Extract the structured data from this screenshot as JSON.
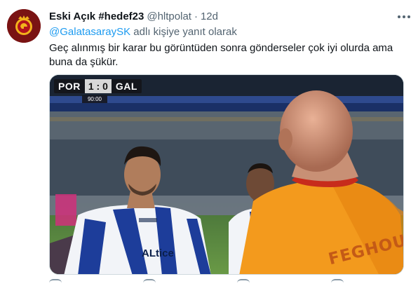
{
  "tweet": {
    "display_name": "Eski Açık #hedef23",
    "handle": "@hltpolat",
    "separator": "·",
    "time": "12d",
    "reply_prefix_mention": "@GalatasaraySK",
    "reply_suffix": "adlı kişiye yanıt olarak",
    "text": "Geç alınmış bir karar bu görüntüden sonra gönderseler çok iyi olurda ama buna da şükür."
  },
  "media": {
    "scorebug": {
      "home": "POR",
      "score": "1 : 0",
      "away": "GAL",
      "clock": "90:00"
    },
    "shirt_name": "FEGHOUL",
    "sponsor_text": "ALtice"
  },
  "colors": {
    "link": "#1d9bf0",
    "secondary_text": "#536471",
    "galatasaray_orange": "#f39a1d",
    "porto_blue": "#1d3d9a"
  },
  "icons": {
    "more": "more-horizontal-icon",
    "avatar": "galatasaray-crest-icon"
  }
}
